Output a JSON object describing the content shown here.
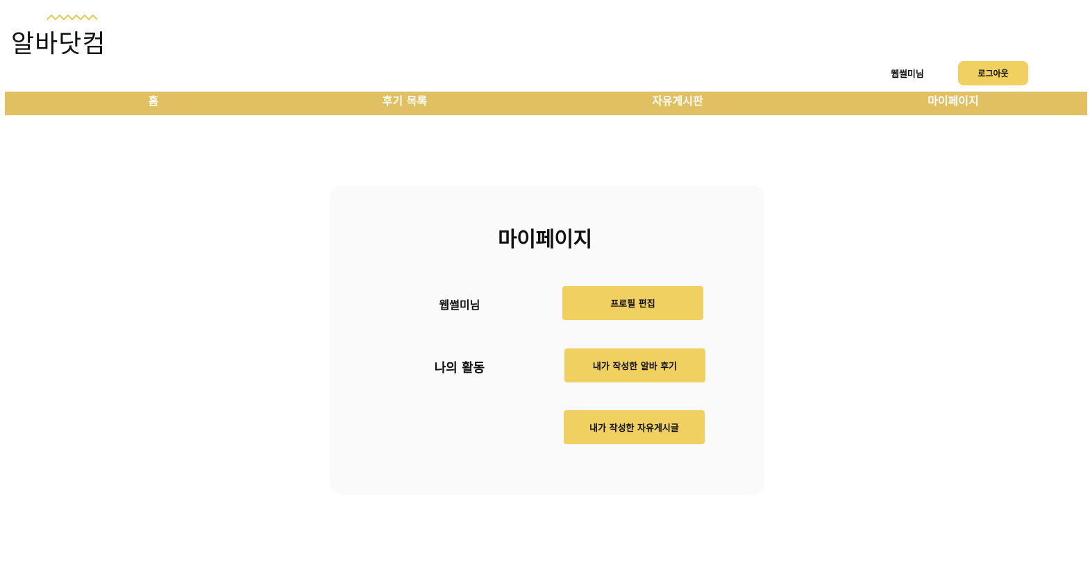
{
  "header": {
    "logo_text": "알바닷컴",
    "user_name": "웹썰미님",
    "logout_label": "로그아웃"
  },
  "nav": {
    "items": [
      {
        "label": "홈"
      },
      {
        "label": "후기 목록"
      },
      {
        "label": "자유게시판"
      },
      {
        "label": "마이페이지"
      }
    ]
  },
  "mypage": {
    "title": "마이페이지",
    "user_name": "웹썰미님",
    "edit_profile_label": "프로필 편집",
    "activity_label": "나의 활동",
    "my_reviews_label": "내가 작성한 알바 후기",
    "my_posts_label": "내가 작성한 자유게시글"
  },
  "colors": {
    "nav_bg": "#e0c060",
    "button_bg": "#f0d060",
    "logo_wave": "#e8c84a",
    "card_bg": "#fafafa"
  },
  "icons": {
    "logo_wave": "wave-icon"
  }
}
